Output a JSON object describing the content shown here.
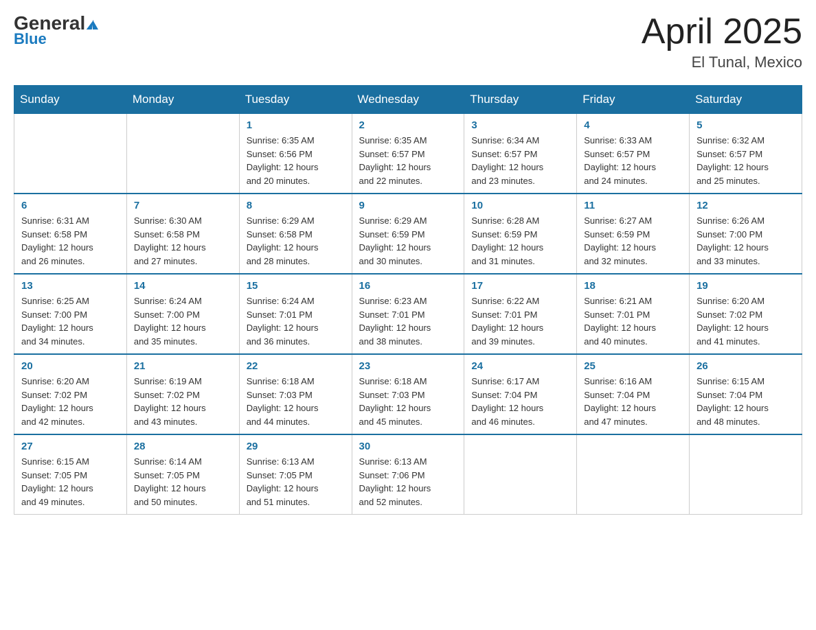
{
  "header": {
    "logo_general": "General",
    "logo_blue": "Blue",
    "month_title": "April 2025",
    "location": "El Tunal, Mexico"
  },
  "weekdays": [
    "Sunday",
    "Monday",
    "Tuesday",
    "Wednesday",
    "Thursday",
    "Friday",
    "Saturday"
  ],
  "weeks": [
    [
      {
        "day": "",
        "info": ""
      },
      {
        "day": "",
        "info": ""
      },
      {
        "day": "1",
        "info": "Sunrise: 6:35 AM\nSunset: 6:56 PM\nDaylight: 12 hours\nand 20 minutes."
      },
      {
        "day": "2",
        "info": "Sunrise: 6:35 AM\nSunset: 6:57 PM\nDaylight: 12 hours\nand 22 minutes."
      },
      {
        "day": "3",
        "info": "Sunrise: 6:34 AM\nSunset: 6:57 PM\nDaylight: 12 hours\nand 23 minutes."
      },
      {
        "day": "4",
        "info": "Sunrise: 6:33 AM\nSunset: 6:57 PM\nDaylight: 12 hours\nand 24 minutes."
      },
      {
        "day": "5",
        "info": "Sunrise: 6:32 AM\nSunset: 6:57 PM\nDaylight: 12 hours\nand 25 minutes."
      }
    ],
    [
      {
        "day": "6",
        "info": "Sunrise: 6:31 AM\nSunset: 6:58 PM\nDaylight: 12 hours\nand 26 minutes."
      },
      {
        "day": "7",
        "info": "Sunrise: 6:30 AM\nSunset: 6:58 PM\nDaylight: 12 hours\nand 27 minutes."
      },
      {
        "day": "8",
        "info": "Sunrise: 6:29 AM\nSunset: 6:58 PM\nDaylight: 12 hours\nand 28 minutes."
      },
      {
        "day": "9",
        "info": "Sunrise: 6:29 AM\nSunset: 6:59 PM\nDaylight: 12 hours\nand 30 minutes."
      },
      {
        "day": "10",
        "info": "Sunrise: 6:28 AM\nSunset: 6:59 PM\nDaylight: 12 hours\nand 31 minutes."
      },
      {
        "day": "11",
        "info": "Sunrise: 6:27 AM\nSunset: 6:59 PM\nDaylight: 12 hours\nand 32 minutes."
      },
      {
        "day": "12",
        "info": "Sunrise: 6:26 AM\nSunset: 7:00 PM\nDaylight: 12 hours\nand 33 minutes."
      }
    ],
    [
      {
        "day": "13",
        "info": "Sunrise: 6:25 AM\nSunset: 7:00 PM\nDaylight: 12 hours\nand 34 minutes."
      },
      {
        "day": "14",
        "info": "Sunrise: 6:24 AM\nSunset: 7:00 PM\nDaylight: 12 hours\nand 35 minutes."
      },
      {
        "day": "15",
        "info": "Sunrise: 6:24 AM\nSunset: 7:01 PM\nDaylight: 12 hours\nand 36 minutes."
      },
      {
        "day": "16",
        "info": "Sunrise: 6:23 AM\nSunset: 7:01 PM\nDaylight: 12 hours\nand 38 minutes."
      },
      {
        "day": "17",
        "info": "Sunrise: 6:22 AM\nSunset: 7:01 PM\nDaylight: 12 hours\nand 39 minutes."
      },
      {
        "day": "18",
        "info": "Sunrise: 6:21 AM\nSunset: 7:01 PM\nDaylight: 12 hours\nand 40 minutes."
      },
      {
        "day": "19",
        "info": "Sunrise: 6:20 AM\nSunset: 7:02 PM\nDaylight: 12 hours\nand 41 minutes."
      }
    ],
    [
      {
        "day": "20",
        "info": "Sunrise: 6:20 AM\nSunset: 7:02 PM\nDaylight: 12 hours\nand 42 minutes."
      },
      {
        "day": "21",
        "info": "Sunrise: 6:19 AM\nSunset: 7:02 PM\nDaylight: 12 hours\nand 43 minutes."
      },
      {
        "day": "22",
        "info": "Sunrise: 6:18 AM\nSunset: 7:03 PM\nDaylight: 12 hours\nand 44 minutes."
      },
      {
        "day": "23",
        "info": "Sunrise: 6:18 AM\nSunset: 7:03 PM\nDaylight: 12 hours\nand 45 minutes."
      },
      {
        "day": "24",
        "info": "Sunrise: 6:17 AM\nSunset: 7:04 PM\nDaylight: 12 hours\nand 46 minutes."
      },
      {
        "day": "25",
        "info": "Sunrise: 6:16 AM\nSunset: 7:04 PM\nDaylight: 12 hours\nand 47 minutes."
      },
      {
        "day": "26",
        "info": "Sunrise: 6:15 AM\nSunset: 7:04 PM\nDaylight: 12 hours\nand 48 minutes."
      }
    ],
    [
      {
        "day": "27",
        "info": "Sunrise: 6:15 AM\nSunset: 7:05 PM\nDaylight: 12 hours\nand 49 minutes."
      },
      {
        "day": "28",
        "info": "Sunrise: 6:14 AM\nSunset: 7:05 PM\nDaylight: 12 hours\nand 50 minutes."
      },
      {
        "day": "29",
        "info": "Sunrise: 6:13 AM\nSunset: 7:05 PM\nDaylight: 12 hours\nand 51 minutes."
      },
      {
        "day": "30",
        "info": "Sunrise: 6:13 AM\nSunset: 7:06 PM\nDaylight: 12 hours\nand 52 minutes."
      },
      {
        "day": "",
        "info": ""
      },
      {
        "day": "",
        "info": ""
      },
      {
        "day": "",
        "info": ""
      }
    ]
  ]
}
